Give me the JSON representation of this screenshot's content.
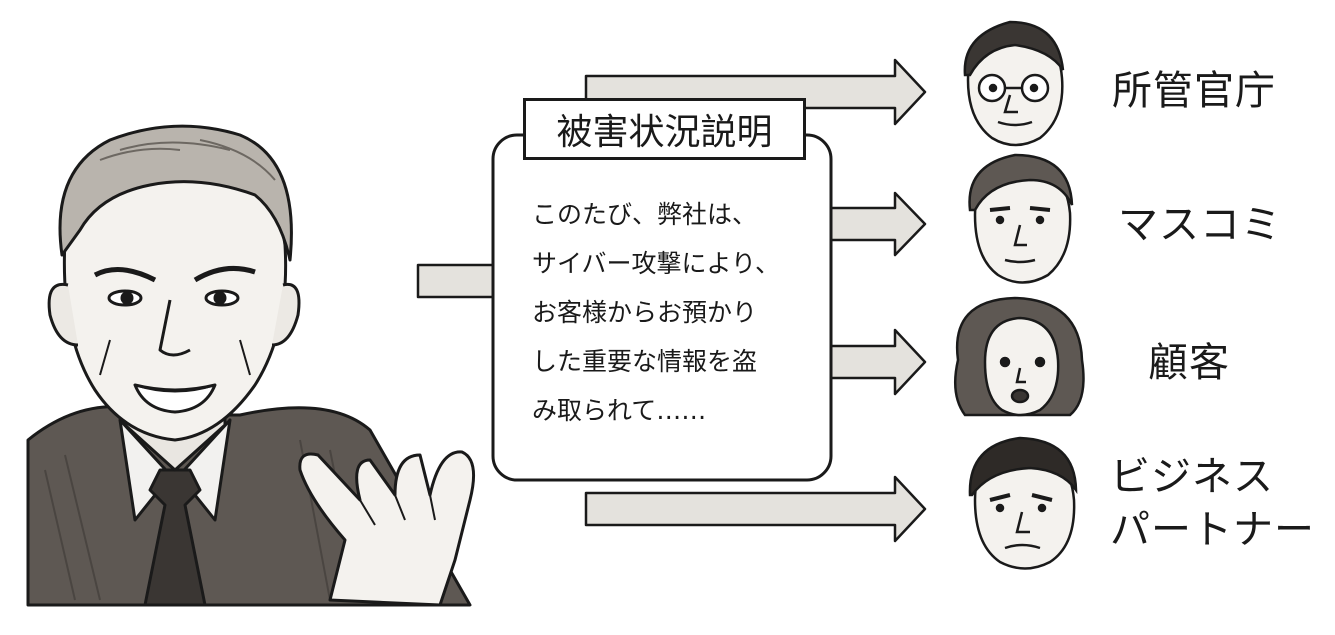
{
  "title": "被害状況説明",
  "statement_lines": [
    "このたび、弊社は、",
    "サイバー攻撃により、",
    "お客様からお預かり",
    "した重要な情報を盗",
    "み取られて……"
  ],
  "recipients": [
    {
      "label": "所管官庁",
      "label_line2": ""
    },
    {
      "label": "マスコミ",
      "label_line2": ""
    },
    {
      "label": "顧客",
      "label_line2": ""
    },
    {
      "label": "ビジネス",
      "label_line2": "パートナー"
    }
  ],
  "colors": {
    "arrow_fill": "#e4e2dd",
    "ink": "#1a1a1a",
    "suit": "#5e5853",
    "tie": "#3a3633"
  }
}
